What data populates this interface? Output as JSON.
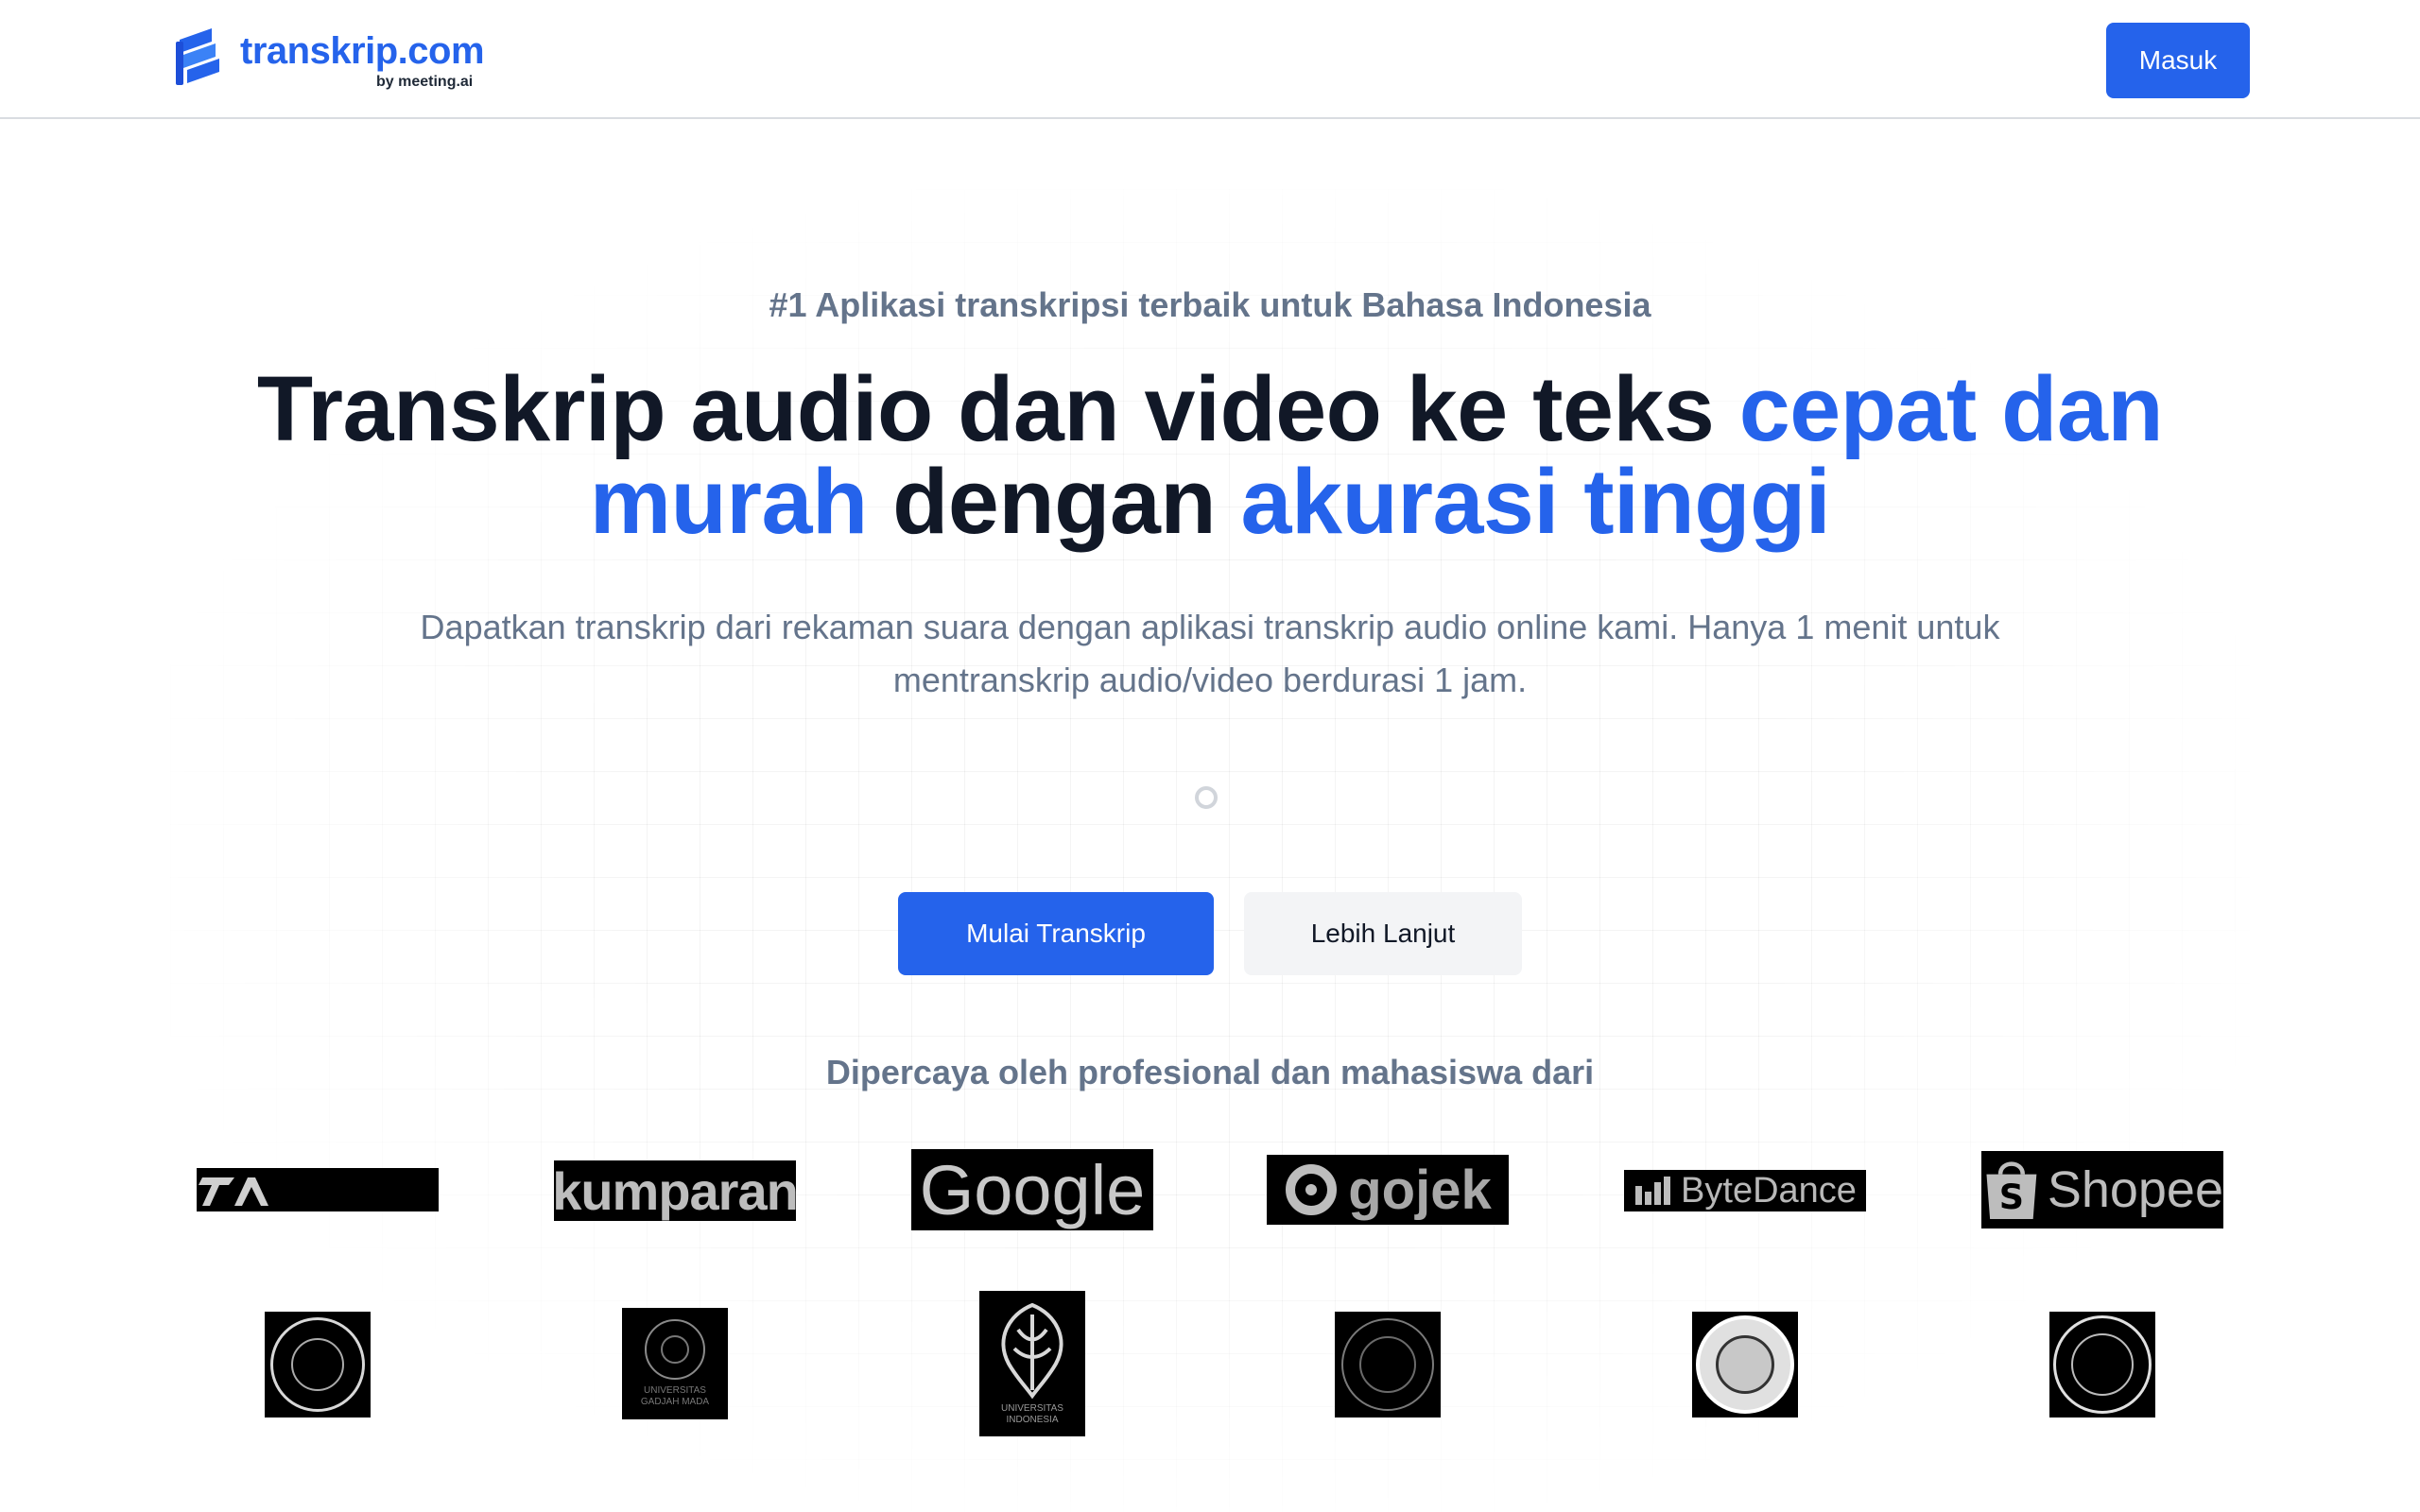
{
  "header": {
    "logo_text": "transkrip.com",
    "logo_sub": "by meeting.ai",
    "login_label": "Masuk"
  },
  "hero": {
    "tagline": "#1 Aplikasi transkripsi terbaik untuk Bahasa Indonesia",
    "headline_part1": "Transkrip audio dan video ke teks ",
    "headline_part2": "cepat dan murah",
    "headline_part3": " dengan ",
    "headline_part4": "akurasi tinggi",
    "subtitle": "Dapatkan transkrip dari rekaman suara dengan aplikasi transkrip audio online kami. Hanya 1 menit untuk mentranskrip audio/video berdurasi 1 jam.",
    "cta_primary": "Mulai Transkrip",
    "cta_secondary": "Lebih Lanjut"
  },
  "trusted": {
    "title": "Dipercaya oleh profesional dan mahasiswa dari",
    "brands": [
      "kumparan",
      "Google",
      "gojek",
      "ByteDance",
      "Shopee"
    ],
    "universities": [
      "UNIVERSITAS GADJAH MADA",
      "UNIVERSITAS INDONESIA"
    ]
  },
  "colors": {
    "accent": "#2563eb",
    "text_dark": "#111827",
    "text_muted": "#64748b"
  }
}
